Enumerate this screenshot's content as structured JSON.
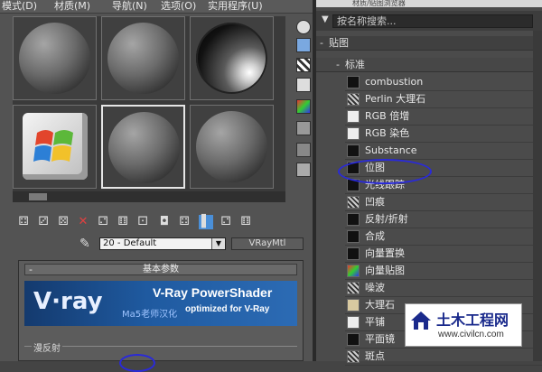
{
  "menubar": {
    "items": [
      "模式(D)",
      "材质(M)",
      "导航(N)",
      "选项(O)",
      "实用程序(U)"
    ]
  },
  "material_editor": {
    "material_name": "20 - Default",
    "material_type": "VRayMtl",
    "rollout_title": "基本参数",
    "rollout_collapse": "-",
    "banner": {
      "logo": "V·ray",
      "product": "V-Ray PowerShader",
      "tagline": "optimized for V-Ray",
      "translator": "Ma5老师汉化"
    },
    "diffuse_label": "漫反射"
  },
  "browser": {
    "title": "材质/贴图浏览器",
    "search_placeholder": "按名称搜索...",
    "group": {
      "toggle": "-",
      "label": "贴图"
    },
    "subgroup": {
      "toggle": "-",
      "label": "标准"
    },
    "items": [
      {
        "label": "combustion",
        "icon": "black-swatch"
      },
      {
        "label": "Perlin 大理石",
        "icon": "marble-swatch"
      },
      {
        "label": "RGB 倍增",
        "icon": "white-swatch"
      },
      {
        "label": "RGB 染色",
        "icon": "white-swatch"
      },
      {
        "label": "Substance",
        "icon": "black-swatch"
      },
      {
        "label": "位图",
        "icon": "black-swatch"
      },
      {
        "label": "光线跟踪",
        "icon": "black-swatch"
      },
      {
        "label": "凹痕",
        "icon": "dent-swatch"
      },
      {
        "label": "反射/折射",
        "icon": "black-swatch"
      },
      {
        "label": "合成",
        "icon": "black-swatch"
      },
      {
        "label": "向量置换",
        "icon": "black-swatch"
      },
      {
        "label": "向量贴图",
        "icon": "color-swatch"
      },
      {
        "label": "噪波",
        "icon": "noise-swatch"
      },
      {
        "label": "大理石",
        "icon": "tan-swatch"
      },
      {
        "label": "平铺",
        "icon": "white-swatch"
      },
      {
        "label": "平面镜",
        "icon": "black-swatch"
      },
      {
        "label": "斑点",
        "icon": "pattern-swatch"
      }
    ]
  },
  "watermark": {
    "name": "土木工程网",
    "url": "www.civilcn.com"
  }
}
